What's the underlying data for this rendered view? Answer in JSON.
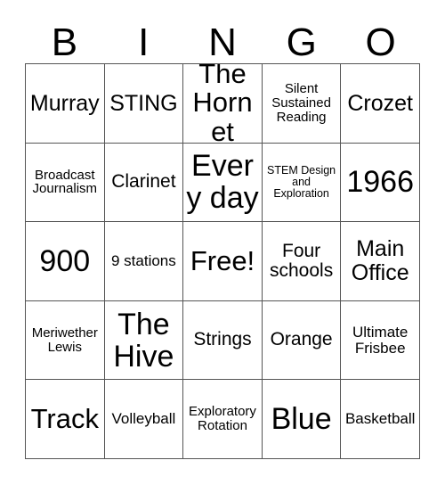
{
  "header": {
    "letters": [
      "B",
      "I",
      "N",
      "G",
      "O"
    ]
  },
  "grid": {
    "rows": [
      [
        {
          "text": "Murray",
          "size": "sz-l"
        },
        {
          "text": "STING",
          "size": "sz-l"
        },
        {
          "text": "The Hornet",
          "size": "sz-xl"
        },
        {
          "text": "Silent Sustained Reading",
          "size": "sz-xs"
        },
        {
          "text": "Crozet",
          "size": "sz-l"
        }
      ],
      [
        {
          "text": "Broadcast Journalism",
          "size": "sz-xs"
        },
        {
          "text": "Clarinet",
          "size": "sz-m"
        },
        {
          "text": "Every day",
          "size": "sz-xxl"
        },
        {
          "text": "STEM Design and Exploration",
          "size": "sz-xxs"
        },
        {
          "text": "1966",
          "size": "sz-xxl"
        }
      ],
      [
        {
          "text": "900",
          "size": "sz-xxl"
        },
        {
          "text": "9 stations",
          "size": "sz-s"
        },
        {
          "text": "Free!",
          "size": "sz-xl"
        },
        {
          "text": "Four schools",
          "size": "sz-m"
        },
        {
          "text": "Main Office",
          "size": "sz-l"
        }
      ],
      [
        {
          "text": "Meriwether Lewis",
          "size": "sz-xs"
        },
        {
          "text": "The Hive",
          "size": "sz-xxl"
        },
        {
          "text": "Strings",
          "size": "sz-m"
        },
        {
          "text": "Orange",
          "size": "sz-m"
        },
        {
          "text": "Ultimate Frisbee",
          "size": "sz-s"
        }
      ],
      [
        {
          "text": "Track",
          "size": "sz-xl"
        },
        {
          "text": "Volleyball",
          "size": "sz-s"
        },
        {
          "text": "Exploratory Rotation",
          "size": "sz-xs"
        },
        {
          "text": "Blue",
          "size": "sz-xxl"
        },
        {
          "text": "Basketball",
          "size": "sz-s"
        }
      ]
    ]
  },
  "colors": {
    "background": "#ffffff",
    "text": "#000000",
    "grid_line": "#555555"
  }
}
